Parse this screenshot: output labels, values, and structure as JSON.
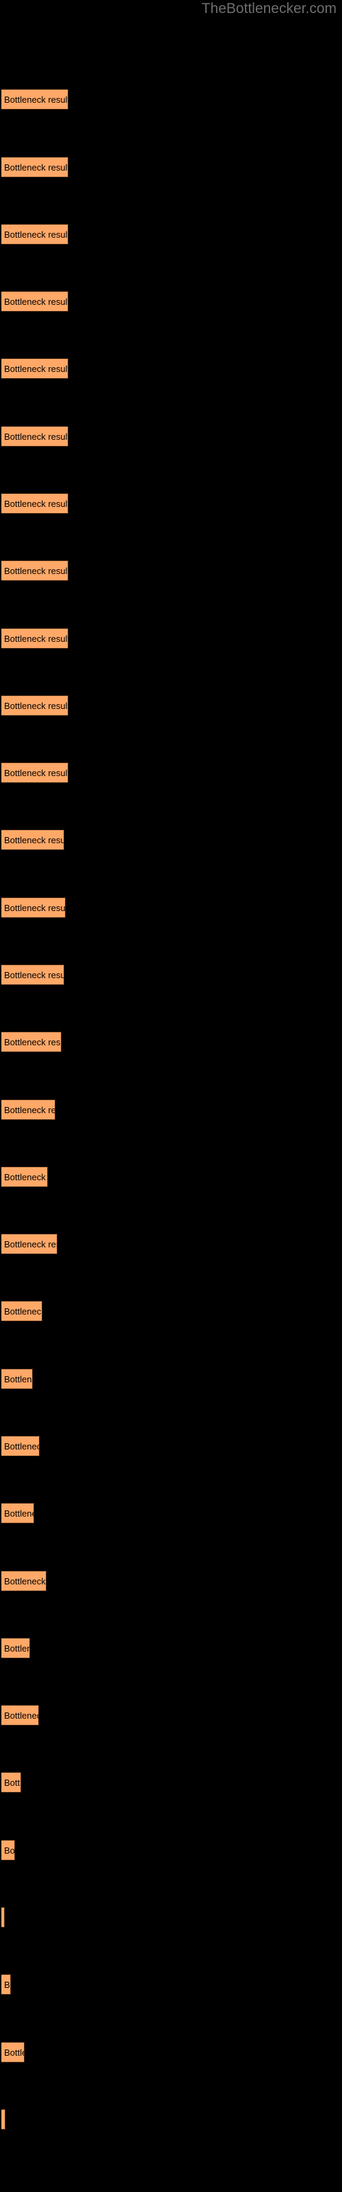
{
  "watermark": {
    "text": "TheBottlenecker.com",
    "color": "#6e6e6e"
  },
  "colors": {
    "background": "#000000",
    "bar_fill": "#ffa868",
    "bar_border": "#4a2a14",
    "bar_label": "#000000"
  },
  "chart_data": {
    "type": "bar",
    "orientation": "horizontal",
    "title": "",
    "subtitle": "",
    "xlabel": "",
    "ylabel": "",
    "grid": false,
    "legend": null,
    "bar_label_text": "Bottleneck result",
    "categories": [
      "",
      "",
      "",
      "",
      "",
      "",
      "",
      "",
      "",
      "",
      "",
      "",
      "",
      "",
      "",
      "",
      "",
      "",
      "",
      "",
      "",
      "",
      "",
      "",
      "",
      "",
      "",
      "",
      "",
      "",
      "",
      "",
      "",
      "",
      "",
      ""
    ],
    "values": [
      98,
      98,
      98,
      98,
      98,
      98,
      98,
      98,
      98,
      98,
      98,
      98,
      88,
      88,
      88,
      75,
      64,
      80,
      58,
      44,
      53,
      45,
      62,
      40,
      51,
      28,
      18,
      5,
      12,
      30,
      5
    ],
    "xlim": [
      0,
      500
    ],
    "bars": [
      {
        "y": 57,
        "width": 98,
        "label": "Bottleneck result"
      },
      {
        "y": 100,
        "width": 98,
        "label": "Bottleneck result"
      },
      {
        "y": 143,
        "width": 98,
        "label": "Bottleneck result"
      },
      {
        "y": 186,
        "width": 98,
        "label": "Bottleneck result"
      },
      {
        "y": 229,
        "width": 98,
        "label": "Bottleneck result"
      },
      {
        "y": 272,
        "width": 98,
        "label": "Bottleneck result"
      },
      {
        "y": 315,
        "width": 98,
        "label": "Bottleneck result"
      },
      {
        "y": 358,
        "width": 98,
        "label": "Bottleneck result"
      },
      {
        "y": 401,
        "width": 98,
        "label": "Bottleneck result"
      },
      {
        "y": 444,
        "width": 98,
        "label": "Bottleneck result"
      },
      {
        "y": 487,
        "width": 98,
        "label": "Bottleneck result"
      },
      {
        "y": 530,
        "width": 92,
        "label": "Bottleneck result"
      },
      {
        "y": 573,
        "width": 94,
        "label": "Bottleneck result"
      },
      {
        "y": 616,
        "width": 92,
        "label": "Bottleneck result"
      },
      {
        "y": 659,
        "width": 88,
        "label": "Bottleneck result"
      },
      {
        "y": 702,
        "width": 79,
        "label": "Bottleneck result"
      },
      {
        "y": 745,
        "width": 68,
        "label": "Bottleneck res"
      },
      {
        "y": 788,
        "width": 82,
        "label": "Bottleneck result"
      },
      {
        "y": 831,
        "width": 60,
        "label": "Bottleneck re"
      },
      {
        "y": 874,
        "width": 46,
        "label": "Bottlenec"
      },
      {
        "y": 917,
        "width": 56,
        "label": "Bottleneck re"
      },
      {
        "y": 960,
        "width": 48,
        "label": "Bottleneck"
      },
      {
        "y": 1003,
        "width": 66,
        "label": "Bottleneck res"
      },
      {
        "y": 1046,
        "width": 42,
        "label": "Bottlene"
      },
      {
        "y": 1089,
        "width": 55,
        "label": "Bottleneck r"
      },
      {
        "y": 1132,
        "width": 29,
        "label": "Bott"
      },
      {
        "y": 1175,
        "width": 20,
        "label": "Bo"
      },
      {
        "y": 1218,
        "width": 5,
        "label": ""
      },
      {
        "y": 1261,
        "width": 14,
        "label": "B"
      },
      {
        "y": 1304,
        "width": 34,
        "label": "Bottle"
      },
      {
        "y": 1347,
        "width": 6,
        "label": ""
      }
    ]
  }
}
